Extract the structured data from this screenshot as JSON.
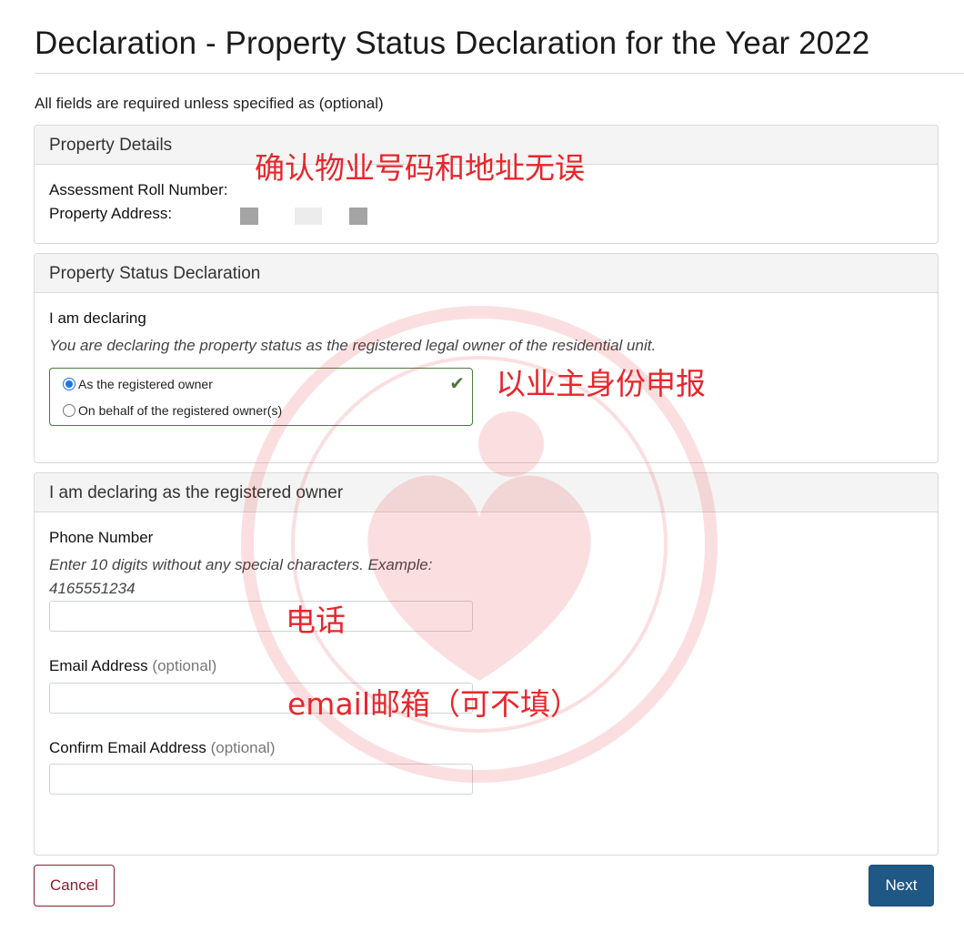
{
  "page": {
    "title": "Declaration - Property Status Declaration for the Year 2022",
    "required_note": "All fields are required unless specified as (optional)"
  },
  "property_details": {
    "header": "Property Details",
    "roll_label": "Assessment Roll Number:",
    "address_label": "Property Address:"
  },
  "status_declaration": {
    "header": "Property Status Declaration",
    "declaring_label": "I am declaring",
    "help_text": "You are declaring the property status as the registered legal owner of the residential unit.",
    "options": [
      {
        "label": "As the registered owner",
        "selected": true
      },
      {
        "label": "On behalf of the registered owner(s)",
        "selected": false
      }
    ]
  },
  "owner_section": {
    "header": "I am declaring as the registered owner",
    "phone_label": "Phone Number",
    "phone_help_line1": "Enter 10 digits without any special characters. Example:",
    "phone_help_line2": "4165551234",
    "phone_value": "",
    "email_label": "Email Address",
    "email_optional": "(optional)",
    "email_value": "",
    "confirm_email_label": "Confirm Email Address",
    "confirm_email_optional": "(optional)",
    "confirm_email_value": ""
  },
  "actions": {
    "cancel_label": "Cancel",
    "next_label": "Next"
  },
  "annotations": {
    "confirm_property": "确认物业号码和地址无误",
    "declare_as_owner": "以业主身份申报",
    "phone": "电话",
    "email_optional": "email邮箱（可不填）"
  },
  "colors": {
    "accent_blue": "#1f5785",
    "cancel_red": "#8a1c2b",
    "success_green": "#4d7a3f",
    "annotation_red": "#e8262b"
  }
}
